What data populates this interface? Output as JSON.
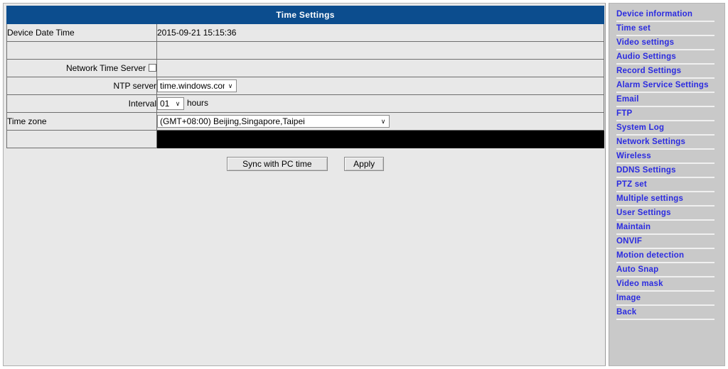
{
  "page": {
    "title": "Time Settings"
  },
  "form": {
    "rows": [
      {
        "label": "Device Date Time",
        "value": "2015-09-21 15:15:36",
        "type": "text-left"
      },
      {
        "label": "",
        "value": "",
        "type": "spacer"
      },
      {
        "label": "Network Time Server",
        "type": "checkbox",
        "checked": false
      },
      {
        "label": "NTP server",
        "type": "select",
        "value": "time.windows.com"
      },
      {
        "label": "Interval",
        "type": "select-units",
        "value": "01",
        "units": "hours"
      },
      {
        "label": "Time zone",
        "type": "select-wide",
        "value": "(GMT+08:00) Beijing,Singapore,Taipei"
      },
      {
        "label": "",
        "type": "black"
      }
    ],
    "labels": {
      "device_date_time": "Device Date Time",
      "network_time_server": "Network Time Server",
      "ntp_server": "NTP server",
      "interval": "Interval",
      "time_zone": "Time zone"
    },
    "values": {
      "device_date_time": "2015-09-21 15:15:36",
      "ntp_server": "time.windows.com",
      "interval": "01",
      "interval_units": "hours",
      "time_zone": "(GMT+08:00) Beijing,Singapore,Taipei"
    },
    "dropdown_arrow": "∨"
  },
  "buttons": {
    "sync": "Sync with PC time",
    "apply": "Apply"
  },
  "sidebar": {
    "items": [
      {
        "label": "Device information"
      },
      {
        "label": "Time set"
      },
      {
        "label": "Video settings"
      },
      {
        "label": "Audio Settings"
      },
      {
        "label": "Record Settings"
      },
      {
        "label": "Alarm Service Settings"
      },
      {
        "label": "Email"
      },
      {
        "label": "FTP"
      },
      {
        "label": "System Log"
      },
      {
        "label": "Network Settings"
      },
      {
        "label": "Wireless"
      },
      {
        "label": "DDNS Settings"
      },
      {
        "label": "PTZ set"
      },
      {
        "label": "Multiple settings"
      },
      {
        "label": "User Settings"
      },
      {
        "label": "Maintain"
      },
      {
        "label": "ONVIF"
      },
      {
        "label": "Motion detection"
      },
      {
        "label": "Auto Snap"
      },
      {
        "label": "Video mask"
      },
      {
        "label": "Image"
      },
      {
        "label": "Back"
      }
    ]
  },
  "colors": {
    "title_bar": "#0c4d8e",
    "title_text": "#ffffff",
    "sidebar_bg": "#c9c9c9",
    "link": "#2b2be0",
    "content_bg": "#e8e8e8",
    "black_row": "#000000"
  }
}
